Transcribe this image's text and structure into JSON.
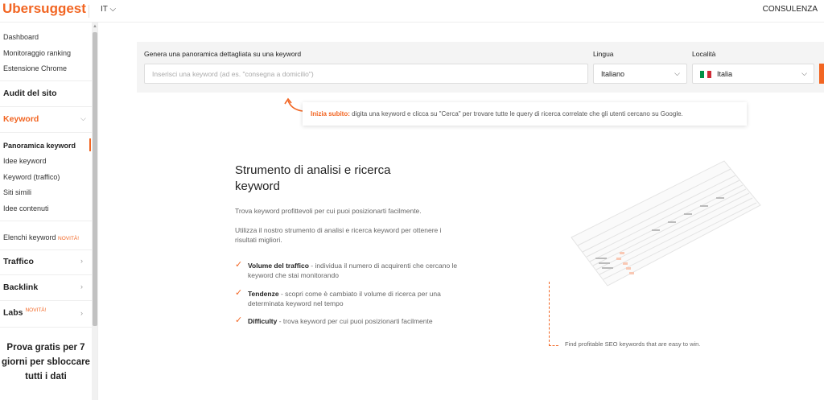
{
  "header": {
    "logo": "Ubersuggest",
    "language": "IT",
    "consulting": "CONSULENZA"
  },
  "sidebar": {
    "top_links": [
      "Dashboard",
      "Monitoraggio ranking",
      "Estensione Chrome"
    ],
    "site_audit": "Audit del sito",
    "keyword": "Keyword",
    "keyword_items": [
      "Panoramica keyword",
      "Idee keyword",
      "Keyword (traffico)",
      "Siti simili",
      "Idee contenuti"
    ],
    "keyword_lists": "Elenchi keyword",
    "new_badge": "NOVITÀ!",
    "traffic": "Traffico",
    "backlink": "Backlink",
    "labs": "Labs",
    "labs_badge": "NOVITÀ!",
    "promo": "Prova gratis per 7 giorni per sbloccare tutti i dati"
  },
  "search": {
    "label": "Genera una panoramica dettagliata su una keyword",
    "placeholder": "Inserisci una keyword (ad es. \"consegna a domicilio\")",
    "language_label": "Lingua",
    "language_value": "Italiano",
    "location_label": "Località",
    "location_value": "Italia"
  },
  "hint": {
    "strong": "Inizia subito:",
    "text": " digita una keyword e clicca su \"Cerca\" per trovare tutte le query di ricerca correlate che gli utenti cercano su Google."
  },
  "hero": {
    "title": "Strumento di analisi e ricerca keyword",
    "p1": "Trova keyword profittevoli per cui puoi posizionarti facilmente.",
    "p2": "Utilizza il nostro strumento di analisi e ricerca keyword per ottenere i risultati migliori.",
    "features": [
      {
        "title": "Volume del traffico",
        "text": " - individua il numero di acquirenti che cercano le keyword che stai monitorando"
      },
      {
        "title": "Tendenze",
        "text": " - scopri come è cambiato il volume di ricerca per una determinata keyword nel tempo"
      },
      {
        "title": "Difficulty",
        "text": " - trova keyword per cui puoi posizionarti facilmente"
      }
    ]
  },
  "illustration": {
    "caption": "Find profitable SEO keywords that are easy to win."
  },
  "colors": {
    "accent": "#f26522",
    "panel": "#f4f4f4",
    "flag_green": "#009246",
    "flag_red": "#ce2b37"
  }
}
